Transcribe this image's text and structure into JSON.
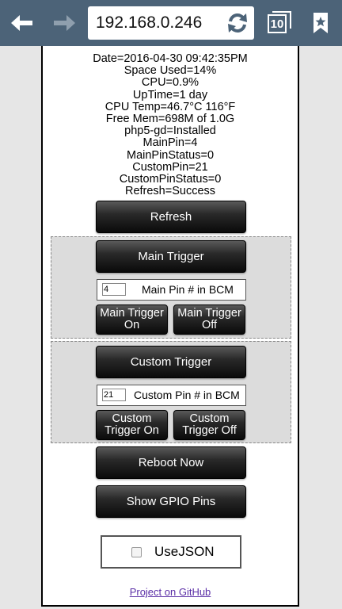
{
  "browser": {
    "url": "192.168.0.246",
    "tab_count": "10"
  },
  "status_lines": [
    "Date=2016-04-30 09:42:35PM",
    "Space Used=14%",
    "CPU=0.9%",
    "UpTime=1 day",
    "CPU Temp=46.7°C 116°F",
    "Free Mem=698M of 1.0G",
    "php5-gd=Installed",
    "MainPin=4",
    "MainPinStatus=0",
    "CustomPin=21",
    "CustomPinStatus=0",
    "Refresh=Success"
  ],
  "buttons": {
    "refresh": "Refresh",
    "main_trigger": "Main Trigger",
    "main_on": "Main Trigger On",
    "main_off": "Main Trigger Off",
    "custom_trigger": "Custom Trigger",
    "custom_on": "Custom Trigger On",
    "custom_off": "Custom Trigger Off",
    "reboot": "Reboot Now",
    "gpio": "Show GPIO Pins"
  },
  "main_pin": {
    "value": "4",
    "label": "Main Pin # in BCM"
  },
  "custom_pin": {
    "value": "21",
    "label": "Custom Pin # in BCM"
  },
  "use_json": {
    "label": "UseJSON",
    "checked": false
  },
  "github_link": "Project on GitHub",
  "colors": {
    "toolbar": "#4c6378",
    "link": "#5a2ea6",
    "group_bg": "#dcdcdc"
  }
}
